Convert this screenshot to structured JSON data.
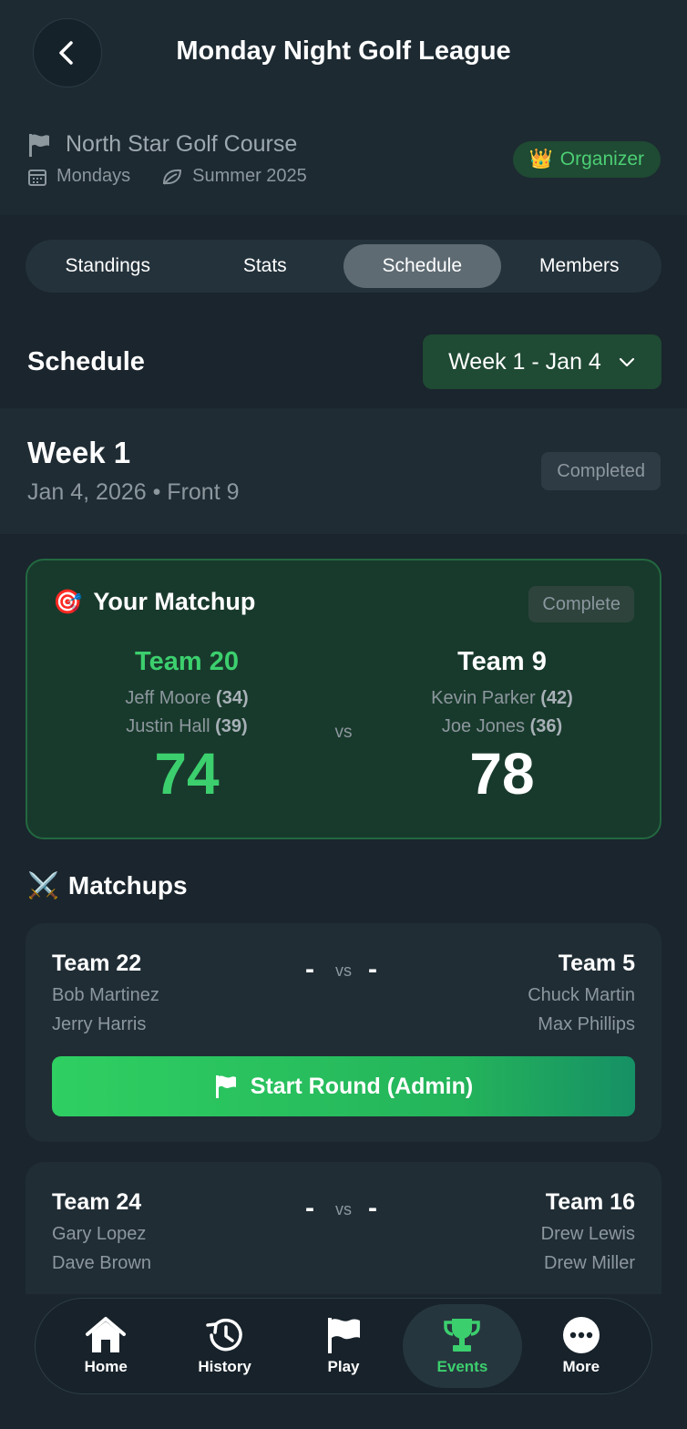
{
  "header": {
    "title": "Monday Night Golf League",
    "course": "North Star Golf Course",
    "day": "Mondays",
    "season": "Summer 2025",
    "role_badge": "Organizer"
  },
  "tabs": [
    "Standings",
    "Stats",
    "Schedule",
    "Members"
  ],
  "active_tab": "Schedule",
  "schedule": {
    "title": "Schedule",
    "selected_week": "Week 1 - Jan 4"
  },
  "week": {
    "name": "Week 1",
    "subtitle": "Jan 4, 2026 • Front 9",
    "status": "Completed"
  },
  "your_matchup": {
    "title": "Your Matchup",
    "status": "Complete",
    "vs": "vs",
    "home": {
      "team": "Team 20",
      "players": [
        {
          "name": "Jeff Moore",
          "score": "(34)"
        },
        {
          "name": "Justin Hall",
          "score": "(39)"
        }
      ],
      "total": "74"
    },
    "away": {
      "team": "Team 9",
      "players": [
        {
          "name": "Kevin Parker",
          "score": "(42)"
        },
        {
          "name": "Joe Jones",
          "score": "(36)"
        }
      ],
      "total": "78"
    }
  },
  "matchups": {
    "title": "Matchups",
    "items": [
      {
        "left_team": "Team 22",
        "left_players": [
          "Bob Martinez",
          "Jerry Harris"
        ],
        "left_score": "-",
        "vs": "vs",
        "right_team": "Team 5",
        "right_players": [
          "Chuck Martin",
          "Max Phillips"
        ],
        "right_score": "-",
        "action": "Start Round (Admin)"
      },
      {
        "left_team": "Team 24",
        "left_players": [
          "Gary Lopez",
          "Dave Brown"
        ],
        "left_score": "-",
        "vs": "vs",
        "right_team": "Team 16",
        "right_players": [
          "Drew Lewis",
          "Drew Miller"
        ],
        "right_score": "-"
      }
    ]
  },
  "nav": {
    "items": [
      "Home",
      "History",
      "Play",
      "Events",
      "More"
    ],
    "active": "Events"
  },
  "colors": {
    "accent_green": "#3ccf6e",
    "background": "#1a252d",
    "card": "#202d35"
  }
}
